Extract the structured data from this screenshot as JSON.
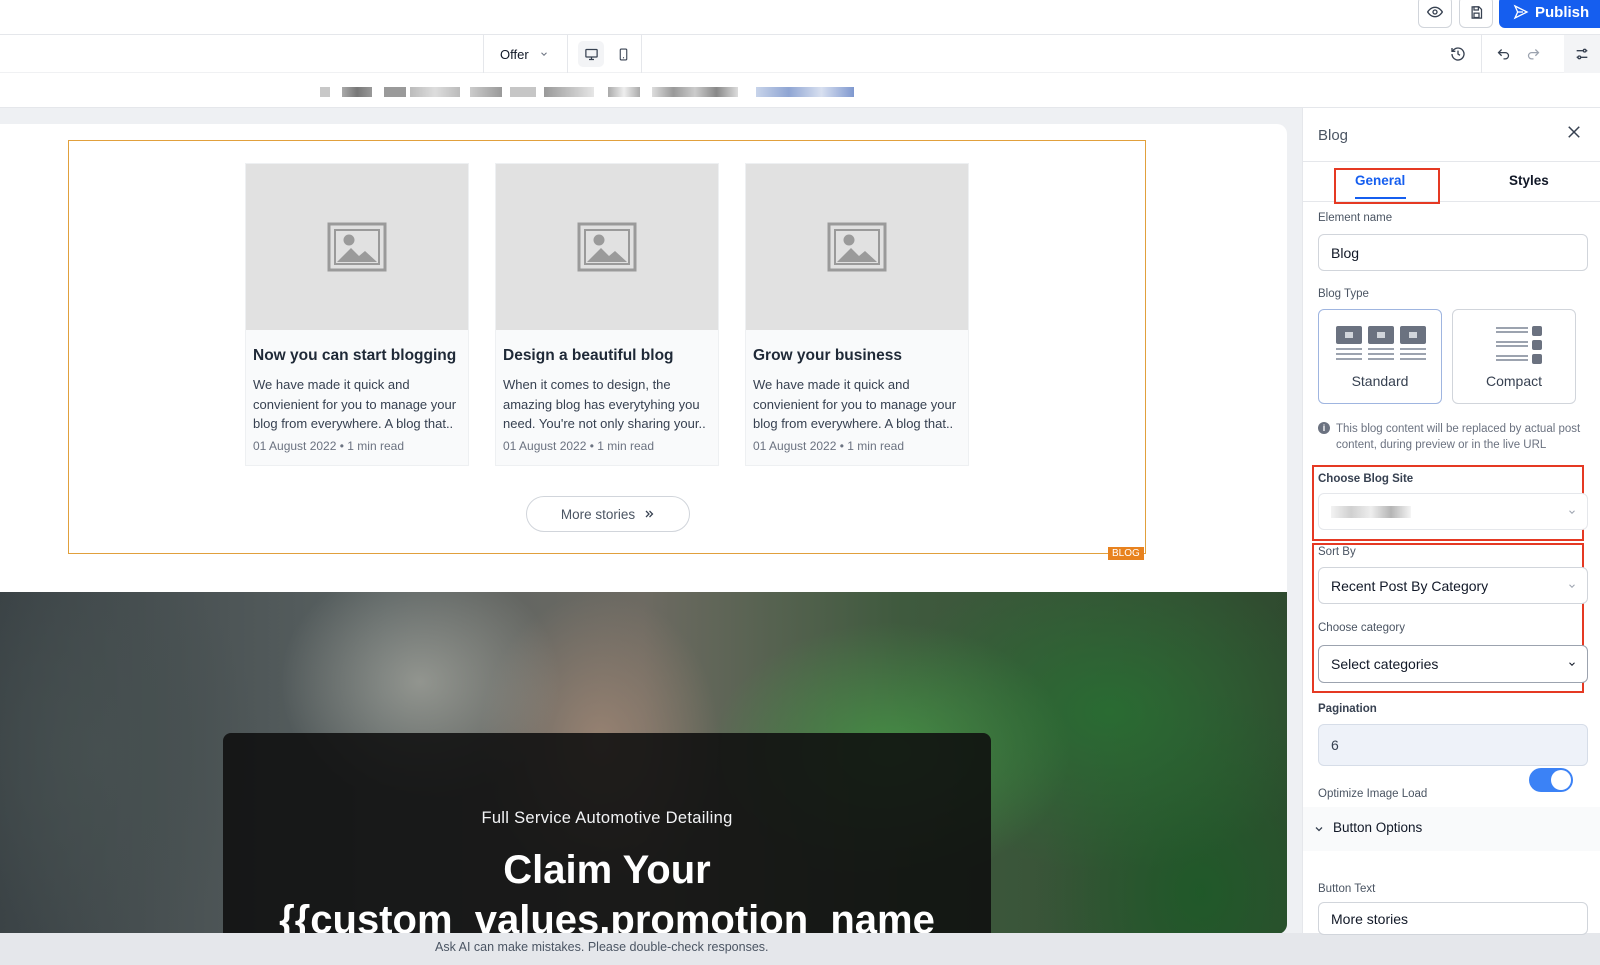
{
  "toolbar": {
    "publish_label": "Publish",
    "page_select_value": "Offer",
    "icons": [
      "eye-icon",
      "save-icon",
      "history-icon",
      "undo-icon",
      "redo-icon",
      "settings-sliders-icon",
      "desktop-icon",
      "mobile-icon"
    ]
  },
  "canvas": {
    "blog": {
      "tag": "BLOG",
      "cards": [
        {
          "title": "Now you can start blogging",
          "excerpt": "We have made it quick and convienient for you to manage your blog from everywhere. A blog that..",
          "date": "01 August 2022",
          "read": "1 min read"
        },
        {
          "title": "Design a beautiful blog",
          "excerpt": "When it comes to design, the amazing blog has everytyhing you need. You're not only sharing your..",
          "date": "01 August 2022",
          "read": "1 min read"
        },
        {
          "title": "Grow your business",
          "excerpt": "We have made it quick and convienient for you to manage your blog from everywhere. A blog that..",
          "date": "01 August 2022",
          "read": "1 min read"
        }
      ],
      "more_label": "More stories"
    },
    "hero": {
      "subtitle": "Full Service Automotive Detailing",
      "title_line1": "Claim Your",
      "title_line2": "{{custom_values.promotion_name"
    },
    "bottom_note": "Ask AI can make mistakes. Please double-check responses."
  },
  "panel": {
    "title": "Blog",
    "tabs": {
      "general": "General",
      "styles": "Styles"
    },
    "element_name_label": "Element name",
    "element_name_value": "Blog",
    "blog_type_label": "Blog Type",
    "blog_types": {
      "standard": "Standard",
      "compact": "Compact"
    },
    "info_text": "This blog content will be replaced by actual post content, during preview or in the live URL",
    "choose_site_label": "Choose Blog Site",
    "sort_by_label": "Sort By",
    "sort_by_value": "Recent Post By Category",
    "category_label": "Choose category",
    "category_value": "Select categories",
    "pagination_label": "Pagination",
    "pagination_value": "6",
    "optimize_label": "Optimize Image Load",
    "optimize_on": true,
    "button_options_label": "Button Options",
    "button_text_label": "Button Text",
    "button_text_value": "More stories"
  },
  "colors": {
    "accent": "#155eef",
    "blog_outline": "#e1a03c",
    "highlight": "#e53923",
    "toggle": "#3b82f6"
  }
}
